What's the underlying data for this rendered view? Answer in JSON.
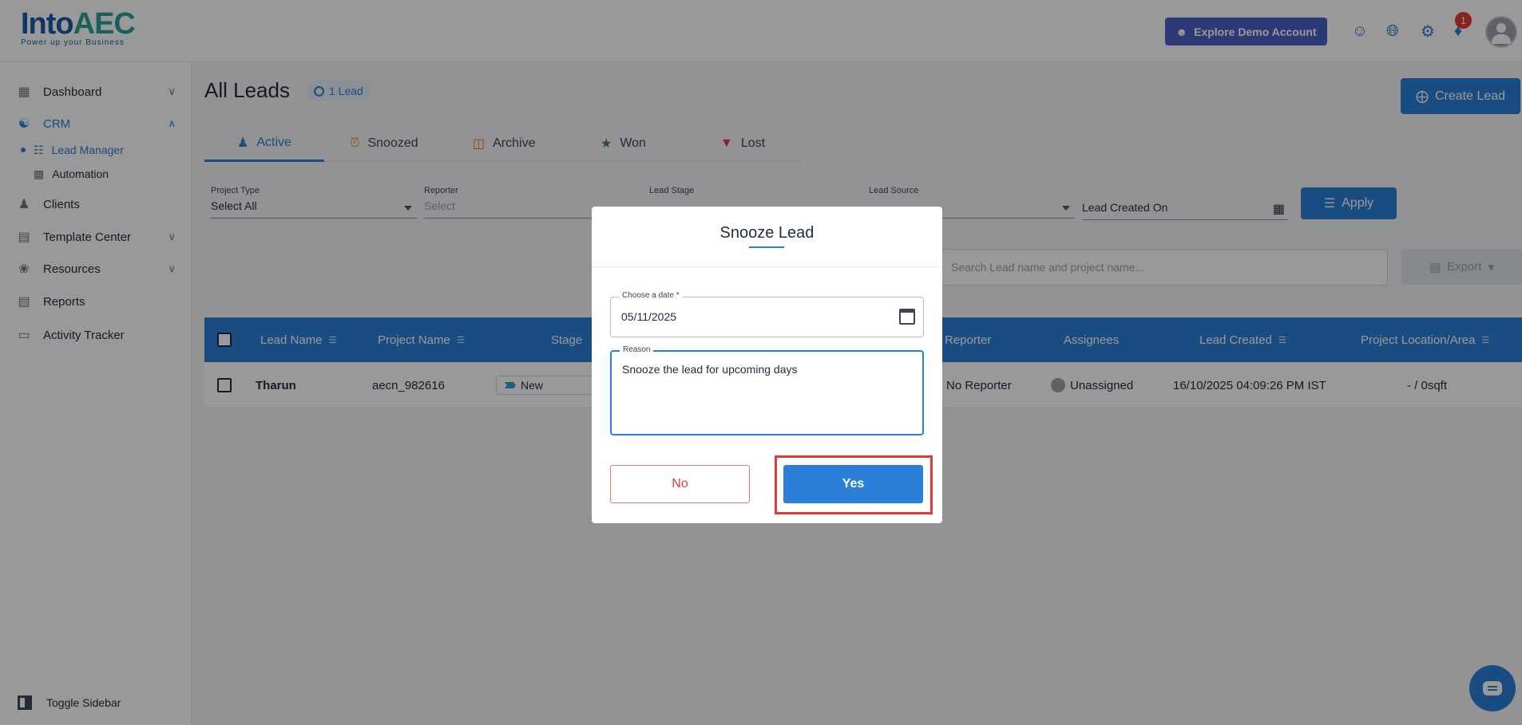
{
  "header": {
    "logo_main": "Into",
    "logo_aec": "AEC",
    "logo_tagline": "Power up your Business",
    "demo_button": "Explore Demo Account",
    "notification_count": "1"
  },
  "sidebar": {
    "items": [
      {
        "label": "Dashboard"
      },
      {
        "label": "CRM"
      },
      {
        "label": "Clients"
      },
      {
        "label": "Template Center"
      },
      {
        "label": "Resources"
      },
      {
        "label": "Reports"
      },
      {
        "label": "Activity Tracker"
      }
    ],
    "sub_items": [
      {
        "label": "Lead Manager"
      },
      {
        "label": "Automation"
      }
    ],
    "toggle_label": "Toggle Sidebar"
  },
  "main": {
    "title": "All Leads",
    "lead_count": "1 Lead",
    "create_button": "Create Lead",
    "tabs": [
      {
        "label": "Active"
      },
      {
        "label": "Snoozed"
      },
      {
        "label": "Archive"
      },
      {
        "label": "Won"
      },
      {
        "label": "Lost"
      }
    ],
    "filters": {
      "project_type_label": "Project Type",
      "project_type_value": "Select All",
      "reporter_label": "Reporter",
      "reporter_placeholder": "Select",
      "lead_stage_label": "Lead Stage",
      "lead_source_label": "Lead Source",
      "lead_created_on": "Lead Created On",
      "apply_button": "Apply"
    },
    "search_placeholder": "Search Lead name and project name...",
    "export_button": "Export",
    "table": {
      "columns": [
        "Lead Name",
        "Project Name",
        "Stage",
        "Reporter",
        "Assignees",
        "Lead Created",
        "Project Location/Area"
      ],
      "rows": [
        {
          "lead_name": "Tharun",
          "project_name": "aecn_982616",
          "stage": "New",
          "reporter": "No Reporter",
          "assignees": "Unassigned",
          "lead_created": "16/10/2025 04:09:26 PM IST",
          "location": "- / 0sqft"
        }
      ]
    }
  },
  "dialog": {
    "title": "Snooze Lead",
    "date_label": "Choose a date *",
    "date_value": "05/11/2025",
    "reason_label": "Reason",
    "reason_value": "Snooze the lead for upcoming days",
    "no_button": "No",
    "yes_button": "Yes"
  },
  "colors": {
    "accent": "#2b7fd6",
    "danger": "#e53935",
    "brand_teal": "#2aa39a"
  }
}
